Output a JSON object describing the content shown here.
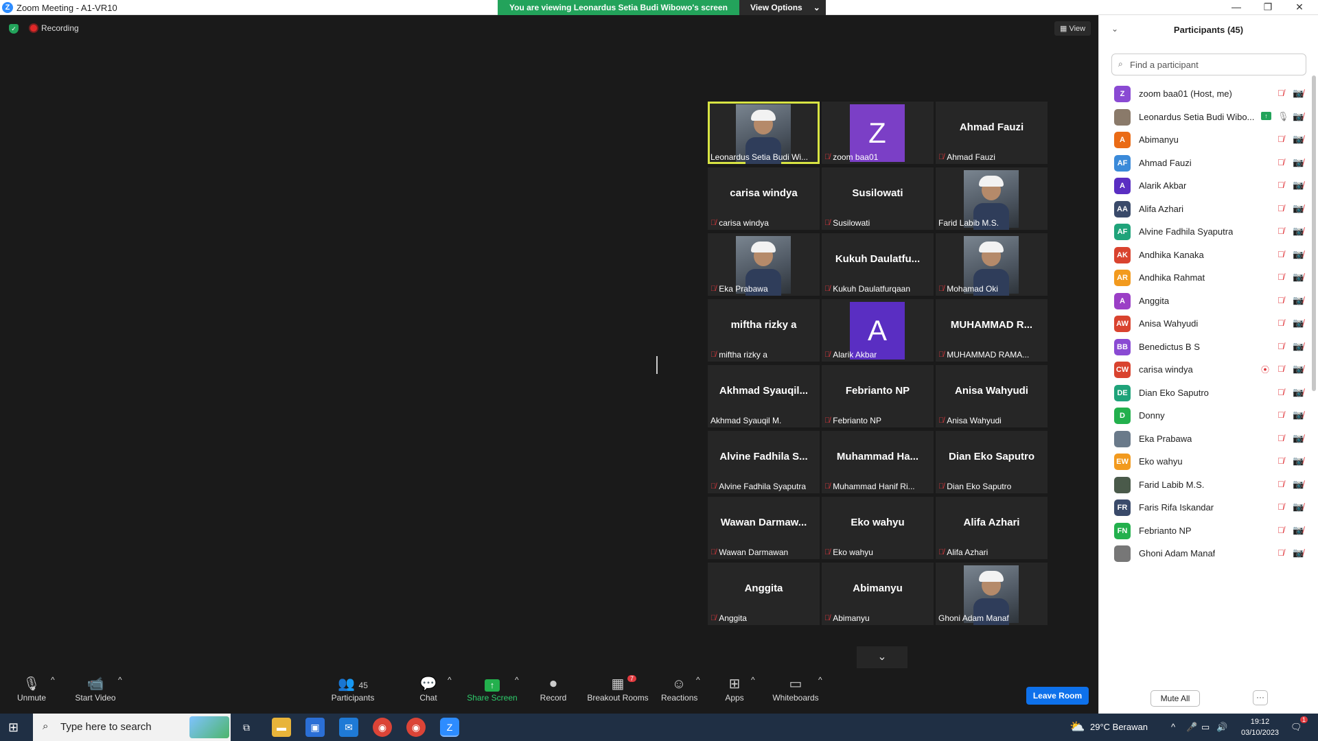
{
  "window": {
    "title": "Zoom Meeting - A1-VR10",
    "app_icon": "Z"
  },
  "banner": {
    "message": "You are viewing Leonardus Setia Budi Wibowo's screen",
    "options": "View Options"
  },
  "meeting": {
    "recording": "Recording",
    "view": "View"
  },
  "tiles": [
    {
      "name": "",
      "label": "Leonardus Setia Budi Wi...",
      "type": "photo",
      "muted": false,
      "active": true
    },
    {
      "name": "",
      "label": "zoom baa01",
      "type": "avatar",
      "letter": "Z",
      "color": "#7b3fc6",
      "muted": true
    },
    {
      "name": "Ahmad Fauzi",
      "label": "Ahmad Fauzi",
      "type": "name",
      "muted": true
    },
    {
      "name": "carisa windya",
      "label": "carisa windya",
      "type": "name",
      "muted": true
    },
    {
      "name": "Susilowati",
      "label": "Susilowati",
      "type": "name",
      "muted": true
    },
    {
      "name": "",
      "label": "Farid Labib M.S.",
      "type": "photo",
      "muted": false
    },
    {
      "name": "",
      "label": "Eka Prabawa",
      "type": "photo",
      "muted": true
    },
    {
      "name": "Kukuh Daulatfu...",
      "label": "Kukuh Daulatfurqaan",
      "type": "name",
      "muted": true
    },
    {
      "name": "",
      "label": "Mohamad Oki",
      "type": "photo",
      "muted": true
    },
    {
      "name": "miftha rizky a",
      "label": "miftha rizky a",
      "type": "name",
      "muted": true
    },
    {
      "name": "",
      "label": "Alarik Akbar",
      "type": "avatar",
      "letter": "A",
      "color": "#5a2ec2",
      "muted": true
    },
    {
      "name": "MUHAMMAD R...",
      "label": "MUHAMMAD RAMA...",
      "type": "name",
      "muted": true
    },
    {
      "name": "Akhmad Syauqil...",
      "label": "Akhmad Syauqil M.",
      "type": "name",
      "muted": false
    },
    {
      "name": "Febrianto NP",
      "label": "Febrianto NP",
      "type": "name",
      "muted": true
    },
    {
      "name": "Anisa Wahyudi",
      "label": "Anisa Wahyudi",
      "type": "name",
      "muted": true
    },
    {
      "name": "Alvine Fadhila S...",
      "label": "Alvine Fadhila Syaputra",
      "type": "name",
      "muted": true
    },
    {
      "name": "Muhammad Ha...",
      "label": "Muhammad Hanif Ri...",
      "type": "name",
      "muted": true
    },
    {
      "name": "Dian Eko Saputro",
      "label": "Dian Eko Saputro",
      "type": "name",
      "muted": true
    },
    {
      "name": "Wawan Darmaw...",
      "label": "Wawan Darmawan",
      "type": "name",
      "muted": true
    },
    {
      "name": "Eko wahyu",
      "label": "Eko wahyu",
      "type": "name",
      "muted": true
    },
    {
      "name": "Alifa Azhari",
      "label": "Alifa Azhari",
      "type": "name",
      "muted": true
    },
    {
      "name": "Anggita",
      "label": "Anggita",
      "type": "name",
      "muted": true
    },
    {
      "name": "Abimanyu",
      "label": "Abimanyu",
      "type": "name",
      "muted": true
    },
    {
      "name": "",
      "label": "Ghoni Adam Manaf",
      "type": "photo",
      "muted": false
    }
  ],
  "toolbar": {
    "unmute": "Unmute",
    "start_video": "Start Video",
    "participants": "Participants",
    "participants_count": "45",
    "chat": "Chat",
    "share_screen": "Share Screen",
    "record": "Record",
    "breakout_rooms": "Breakout Rooms",
    "breakout_badge": "7",
    "reactions": "Reactions",
    "apps": "Apps",
    "whiteboards": "Whiteboards",
    "leave_room": "Leave Room"
  },
  "panel": {
    "title": "Participants (45)",
    "search_placeholder": "Find a participant",
    "mute_all": "Mute All",
    "more": "···",
    "participants": [
      {
        "initials": "Z",
        "name": "zoom baa01 (Host, me)",
        "color": "#8a4ad3"
      },
      {
        "initials": "",
        "name": "Leonardus Setia Budi Wibo...",
        "color": "#8a7a6a",
        "photo": true,
        "sharing": true,
        "mic_on": true
      },
      {
        "initials": "A",
        "name": "Abimanyu",
        "color": "#ea6b16"
      },
      {
        "initials": "AF",
        "name": "Ahmad Fauzi",
        "color": "#3b8ad9"
      },
      {
        "initials": "A",
        "name": "Alarik Akbar",
        "color": "#5a2ec2"
      },
      {
        "initials": "AA",
        "name": "Alifa Azhari",
        "color": "#3a4a6a"
      },
      {
        "initials": "AF",
        "name": "Alvine Fadhila Syaputra",
        "color": "#1fa37a"
      },
      {
        "initials": "AK",
        "name": "Andhika Kanaka",
        "color": "#d9432f"
      },
      {
        "initials": "AR",
        "name": "Andhika Rahmat",
        "color": "#f29a1e"
      },
      {
        "initials": "A",
        "name": "Anggita",
        "color": "#9b3fc6"
      },
      {
        "initials": "AW",
        "name": "Anisa Wahyudi",
        "color": "#d9432f"
      },
      {
        "initials": "BB",
        "name": "Benedictus B S",
        "color": "#8a4ad3"
      },
      {
        "initials": "CW",
        "name": "carisa windya",
        "color": "#d9432f",
        "recording": true
      },
      {
        "initials": "DE",
        "name": "Dian Eko Saputro",
        "color": "#1fa37a"
      },
      {
        "initials": "D",
        "name": "Donny",
        "color": "#23b04d"
      },
      {
        "initials": "",
        "name": "Eka Prabawa",
        "color": "#6a7a8a",
        "photo": true
      },
      {
        "initials": "EW",
        "name": "Eko wahyu",
        "color": "#f29a1e"
      },
      {
        "initials": "",
        "name": "Farid Labib M.S.",
        "color": "#4a5a4a",
        "photo": true
      },
      {
        "initials": "FR",
        "name": "Faris Rifa Iskandar",
        "color": "#3a4a6a"
      },
      {
        "initials": "FN",
        "name": "Febrianto NP",
        "color": "#23b04d"
      },
      {
        "initials": "",
        "name": "Ghoni Adam Manaf",
        "color": "#777777",
        "photo": true
      }
    ]
  },
  "taskbar": {
    "search_placeholder": "Type here to search",
    "weather": "29°C Berawan",
    "time": "19:12",
    "date": "03/10/2023",
    "notification_count": "1"
  }
}
